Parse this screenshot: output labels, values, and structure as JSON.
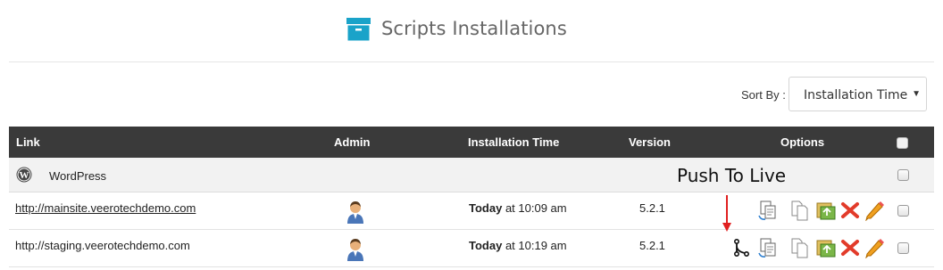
{
  "header": {
    "title": "Scripts Installations",
    "icon": "archive-box-icon"
  },
  "sort": {
    "label": "Sort By :",
    "selected": "Installation Time"
  },
  "table": {
    "columns": [
      "Link",
      "Admin",
      "Installation Time",
      "Version",
      "Options"
    ],
    "group": {
      "name": "WordPress",
      "icon": "wordpress-icon",
      "annotation": "Push To Live"
    },
    "rows": [
      {
        "link": "http://mainsite.veerotechdemo.com",
        "time_day": "Today",
        "time_rest": " at 10:09 am",
        "version": "5.2.1"
      },
      {
        "link": "http://staging.veerotechdemo.com",
        "time_day": "Today",
        "time_rest": " at 10:19 am",
        "version": "5.2.1"
      }
    ]
  },
  "colors": {
    "header_bg": "#3a3a3a",
    "group_bg": "#f2f2f2",
    "icon_teal": "#1aa3c9",
    "delete_red": "#e23b2a",
    "arrow_red": "#e02020"
  }
}
